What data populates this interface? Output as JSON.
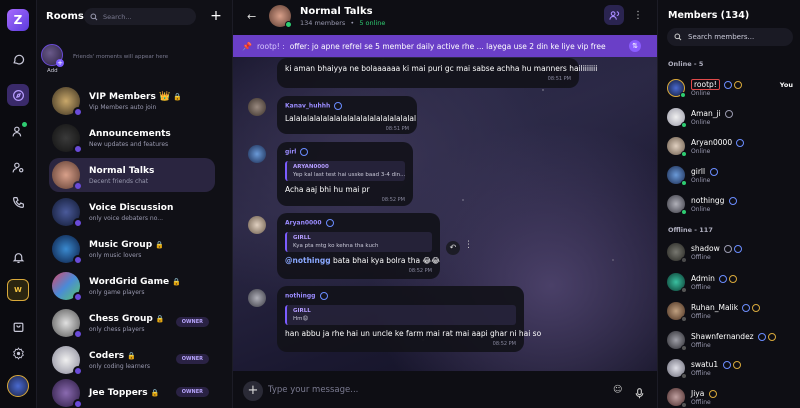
{
  "rooms_panel": {
    "title": "Rooms",
    "search_placeholder": "Search...",
    "add_label": "Add",
    "friends_moments": "Friends' moments will appear here"
  },
  "rooms": [
    {
      "name": "VIP Members",
      "desc": "Vip Members auto join",
      "crown": "👑",
      "lock": true,
      "owner": ""
    },
    {
      "name": "Announcements",
      "desc": "New updates and features",
      "lock": false,
      "owner": ""
    },
    {
      "name": "Normal Talks",
      "desc": "Decent friends chat",
      "lock": false,
      "owner": "",
      "active": true
    },
    {
      "name": "Voice Discussion",
      "desc": "only voice debaters no...",
      "lock": false,
      "owner": ""
    },
    {
      "name": "Music Group",
      "desc": "only music lovers",
      "lock": true,
      "owner": ""
    },
    {
      "name": "WordGrid Game",
      "desc": "only game players",
      "lock": true,
      "owner": ""
    },
    {
      "name": "Chess Group",
      "desc": "only chess players",
      "lock": true,
      "owner": "OWNER"
    },
    {
      "name": "Coders",
      "desc": "only coding learners",
      "lock": true,
      "owner": "OWNER"
    },
    {
      "name": "Jee Toppers",
      "desc": "",
      "lock": true,
      "owner": "OWNER"
    }
  ],
  "chat": {
    "title": "Normal Talks",
    "members_count": "134 members",
    "separator": "•",
    "online_count": "5 online",
    "pinned_user": "rootp! :",
    "pinned_text": "offer: jo apne refrel se 5 member daily active rhe ... layega use 2 din ke liye vip free",
    "input_placeholder": "Type your message..."
  },
  "messages": [
    {
      "text": "ki aman bhaiyya ne bolaaaaaa ki mai puri gc mai sabse achha hu manners hailiiiiiii",
      "time": "08:51 PM"
    },
    {
      "user": "Kanav_huhhh",
      "text": "Lalalalalalalalalalalalalalalalalalalal",
      "time": "08:51 PM"
    },
    {
      "user": "girl",
      "quote_user": "ARYAN0000",
      "quote_text": "Yep kal last test hai usske baad 3-4 din...",
      "text": "Acha aaj bhi hu mai pr",
      "time": "08:52 PM"
    },
    {
      "user": "Aryan0000",
      "quote_user": "GIRLL",
      "quote_text": "Kya pta mtg ko kehna tha kuch",
      "mention": "@nothingg",
      "text": " bata bhai kya bolra tha 😂😂",
      "time": "08:52 PM"
    },
    {
      "user": "nothingg",
      "quote_user": "GIRLL",
      "quote_text": "Hm😩",
      "text": "han abbu ja rhe hai un uncle ke farm mai rat mai aapi ghar ni hai so",
      "time": "08:52 PM"
    }
  ],
  "members_panel": {
    "title": "Members (134)",
    "search_placeholder": "Search members...",
    "online_header": "Online - 5",
    "offline_header": "Offline - 117",
    "you_label": "You"
  },
  "members_online": [
    {
      "name": "rootp!",
      "status": "Online"
    },
    {
      "name": "Aman_ji",
      "status": "Online"
    },
    {
      "name": "Aryan0000",
      "status": "Online"
    },
    {
      "name": "girll",
      "status": "Online"
    },
    {
      "name": "nothingg",
      "status": "Online"
    }
  ],
  "members_offline": [
    {
      "name": "shadow",
      "status": "Offline"
    },
    {
      "name": "Admin",
      "status": "Offline"
    },
    {
      "name": "Ruhan_Malik",
      "status": "Offline"
    },
    {
      "name": "Shawnfernandez",
      "status": "Offline"
    },
    {
      "name": "swatu1",
      "status": "Offline"
    },
    {
      "name": "Jiya",
      "status": "Offline"
    }
  ],
  "colors": {
    "accent": "#7b5cff",
    "online": "#2ecc71",
    "pinned_bar": "#6a3fc7"
  }
}
